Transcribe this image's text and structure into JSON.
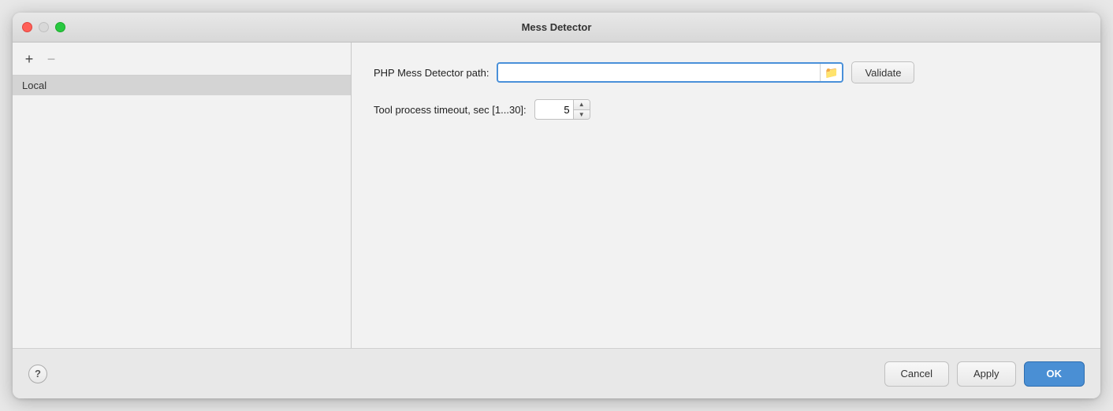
{
  "window": {
    "title": "Mess Detector"
  },
  "sidebar": {
    "add_label": "+",
    "remove_label": "−",
    "items": [
      {
        "label": "Local",
        "selected": true
      }
    ]
  },
  "form": {
    "path_label": "PHP Mess Detector path:",
    "path_value": "",
    "path_placeholder": "",
    "validate_label": "Validate",
    "timeout_label": "Tool process timeout, sec [1...30]:",
    "timeout_value": "5",
    "folder_icon": "🗂"
  },
  "footer": {
    "help_label": "?",
    "cancel_label": "Cancel",
    "apply_label": "Apply",
    "ok_label": "OK"
  }
}
